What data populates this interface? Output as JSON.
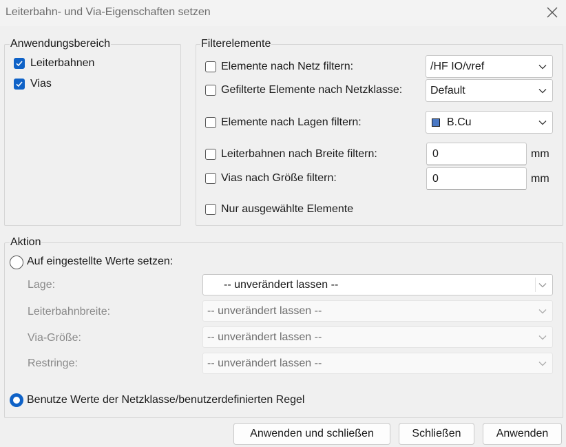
{
  "window": {
    "title": "Leiterbahn- und Via-Eigenschaften setzen",
    "close_icon": "close-icon"
  },
  "scope": {
    "legend": "Anwendungsbereich",
    "items": [
      {
        "label": "Leiterbahnen",
        "checked": true
      },
      {
        "label": "Vias",
        "checked": true
      }
    ]
  },
  "filter": {
    "legend": "Filterelemente",
    "net": {
      "label": "Elemente nach Netz filtern:",
      "value": "/HF IO/vref"
    },
    "netclass": {
      "label": "Gefilterte Elemente nach Netzklasse:",
      "value": "Default"
    },
    "layer": {
      "label": "Elemente nach Lagen filtern:",
      "value": "B.Cu",
      "swatch_color": "#4a78c4"
    },
    "width": {
      "label": "Leiterbahnen nach Breite filtern:",
      "value": "0",
      "unit": "mm"
    },
    "size": {
      "label": "Vias nach Größe filtern:",
      "value": "0",
      "unit": "mm"
    },
    "selected": {
      "label": "Nur ausgewählte Elemente"
    }
  },
  "action": {
    "legend": "Aktion",
    "set_values": {
      "label": "Auf eingestellte Werte setzen:",
      "fields": [
        {
          "label": "Lage:",
          "value": "-- unverändert lassen --"
        },
        {
          "label": "Leiterbahnbreite:",
          "value": "-- unverändert lassen --"
        },
        {
          "label": "Via-Größe:",
          "value": "-- unverändert lassen --"
        },
        {
          "label": "Restringe:",
          "value": "-- unverändert lassen --"
        }
      ]
    },
    "use_netclass": {
      "label": "Benutze Werte der Netzklasse/benutzerdefinierten Regel",
      "selected": true
    }
  },
  "buttons": {
    "apply_close": "Anwenden und schließen",
    "close": "Schließen",
    "apply": "Anwenden"
  },
  "colors": {
    "accent": "#0f62c7"
  }
}
